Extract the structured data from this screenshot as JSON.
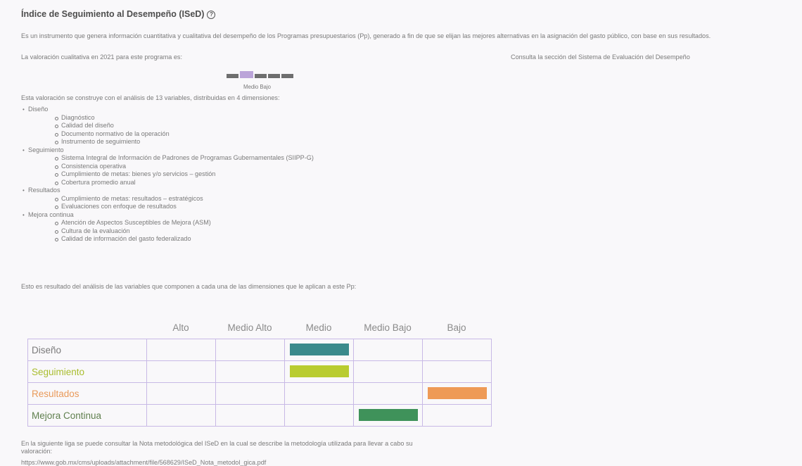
{
  "header": {
    "title": "Índice de Seguimiento al Desempeño (ISeD)",
    "help_icon": "question-circle-icon"
  },
  "intro_text": "Es un instrumento que genera información cuantitativa y cualitativa del desempeño de los Programas presupuestarios (Pp), generado a fin de que se elijan las mejores alternativas en la asignación del gasto público, con base en sus resultados.",
  "valoracion_text": "La valoración cualitativa en 2021 para este programa es:",
  "consulta_text": "Consulta la sección del Sistema de Evaluación del Desempeño",
  "meter": {
    "levels": 5,
    "active_index": 1,
    "label": "Medio Bajo",
    "colors": {
      "active": "#bba4d9",
      "inactive": "#6e6e6e"
    }
  },
  "construye_text": "Esta valoración se construye con el análisis de 13 variables, distribuidas en 4 dimensiones:",
  "dimensions": [
    {
      "name": "Diseño",
      "items": [
        "Diagnóstico",
        "Calidad del diseño",
        "Documento normativo de la operación",
        "Instrumento de seguimiento"
      ]
    },
    {
      "name": "Seguimiento",
      "items": [
        "Sistema Integral de Información de Padrones de Programas Gubernamentales (SIIPP-G)",
        "Consistencia operativa",
        "Cumplimiento de metas: bienes y/o servicios – gestión",
        "Cobertura promedio anual"
      ]
    },
    {
      "name": "Resultados",
      "items": [
        "Cumplimiento de metas: resultados – estratégicos",
        "Evaluaciones con enfoque de resultados"
      ]
    },
    {
      "name": "Mejora continua",
      "items": [
        "Atención de Aspectos Susceptibles de Mejora (ASM)",
        "Cultura de la evaluación",
        "Calidad de información del gasto federalizado"
      ]
    }
  ],
  "resultado_text": "Esto es resultado del análisis de las variables que componen a cada una de las dimensiones que le aplican a este Pp:",
  "grid": {
    "columns": [
      "Alto",
      "Medio Alto",
      "Medio",
      "Medio Bajo",
      "Bajo"
    ],
    "rows": [
      {
        "label": "Diseño",
        "level": "Medio",
        "label_color": "#7a7a7a",
        "bar_color": "#3a8a8c"
      },
      {
        "label": "Seguimiento",
        "level": "Medio",
        "label_color": "#a9bd2e",
        "bar_color": "#b9cc30"
      },
      {
        "label": "Resultados",
        "level": "Bajo",
        "label_color": "#e99a5a",
        "bar_color": "#ee9a56"
      },
      {
        "label": "Mejora Continua",
        "level": "Medio Bajo",
        "label_color": "#5f7f4e",
        "bar_color": "#3f925a"
      }
    ]
  },
  "nota_text_1": "En la siguiente liga se puede consultar la Nota metodológica del ISeD en la cual se describe la metodología utilizada para llevar a cabo su",
  "nota_text_2": "valoración:",
  "nota_link": "https://www.gob.mx/cms/uploads/attachment/file/568629/ISeD_Nota_metodol_gica.pdf"
}
